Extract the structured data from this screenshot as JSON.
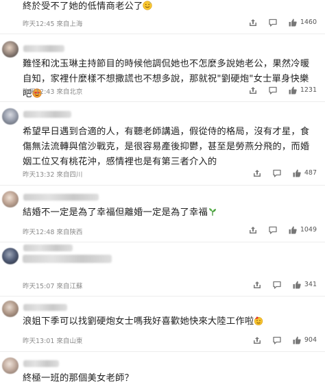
{
  "comments": [
    {
      "text": "終於受不了她的低情商老公了",
      "emoji": "sweat-smile",
      "time": "昨天12:45",
      "location": "來自上海",
      "likes": "1460"
    },
    {
      "text": "難怪和沈玉琳主持節目的時候他調侃她也不怎麼多說她老公，果然冷暖自知，家裡什麼樣不想撒謊也不想多說，那就祝\"劉硬炮\"女士單身快樂吧",
      "emoji": "heart-face",
      "time": "昨天12:43",
      "location": "來自北京",
      "likes": "1231"
    },
    {
      "text": "希望早日遇到合適的人，有聽老師講過，假從侍的格局，沒有才星，食傷無法流轉與倌沙戰克，是很容易產後抑鬱，甚至是勞燕分飛的，而婚姻工位又有桃花沖，感情裡也是有第三者介入的",
      "emoji": "",
      "time": "昨天13:32",
      "location": "來自四川",
      "likes": "487"
    },
    {
      "text": "結婚不一定是為了幸福但離婚一定是為了幸福",
      "emoji": "plant",
      "time": "昨天12:48",
      "location": "來自陝西",
      "likes": "1049"
    },
    {
      "text": "",
      "emoji": "",
      "time": "昨天15:07",
      "location": "來自江蘇",
      "likes": "341"
    },
    {
      "text": "浪姐下季可以找劉硬炮女士嗎我好喜歡她快來大陸工作啦",
      "emoji": "party-face",
      "time": "昨天13:01",
      "location": "來自山東",
      "likes": "904"
    },
    {
      "text": "終極一班的那個美女老師？",
      "emoji": "",
      "time": "",
      "location": "",
      "likes": ""
    }
  ],
  "icons": {
    "share": "share-icon",
    "comment": "comment-icon",
    "like": "thumbs-up-icon"
  },
  "colors": {
    "meta_text": "#8a8a8a",
    "body_text": "#222222",
    "divider": "#ececec"
  }
}
